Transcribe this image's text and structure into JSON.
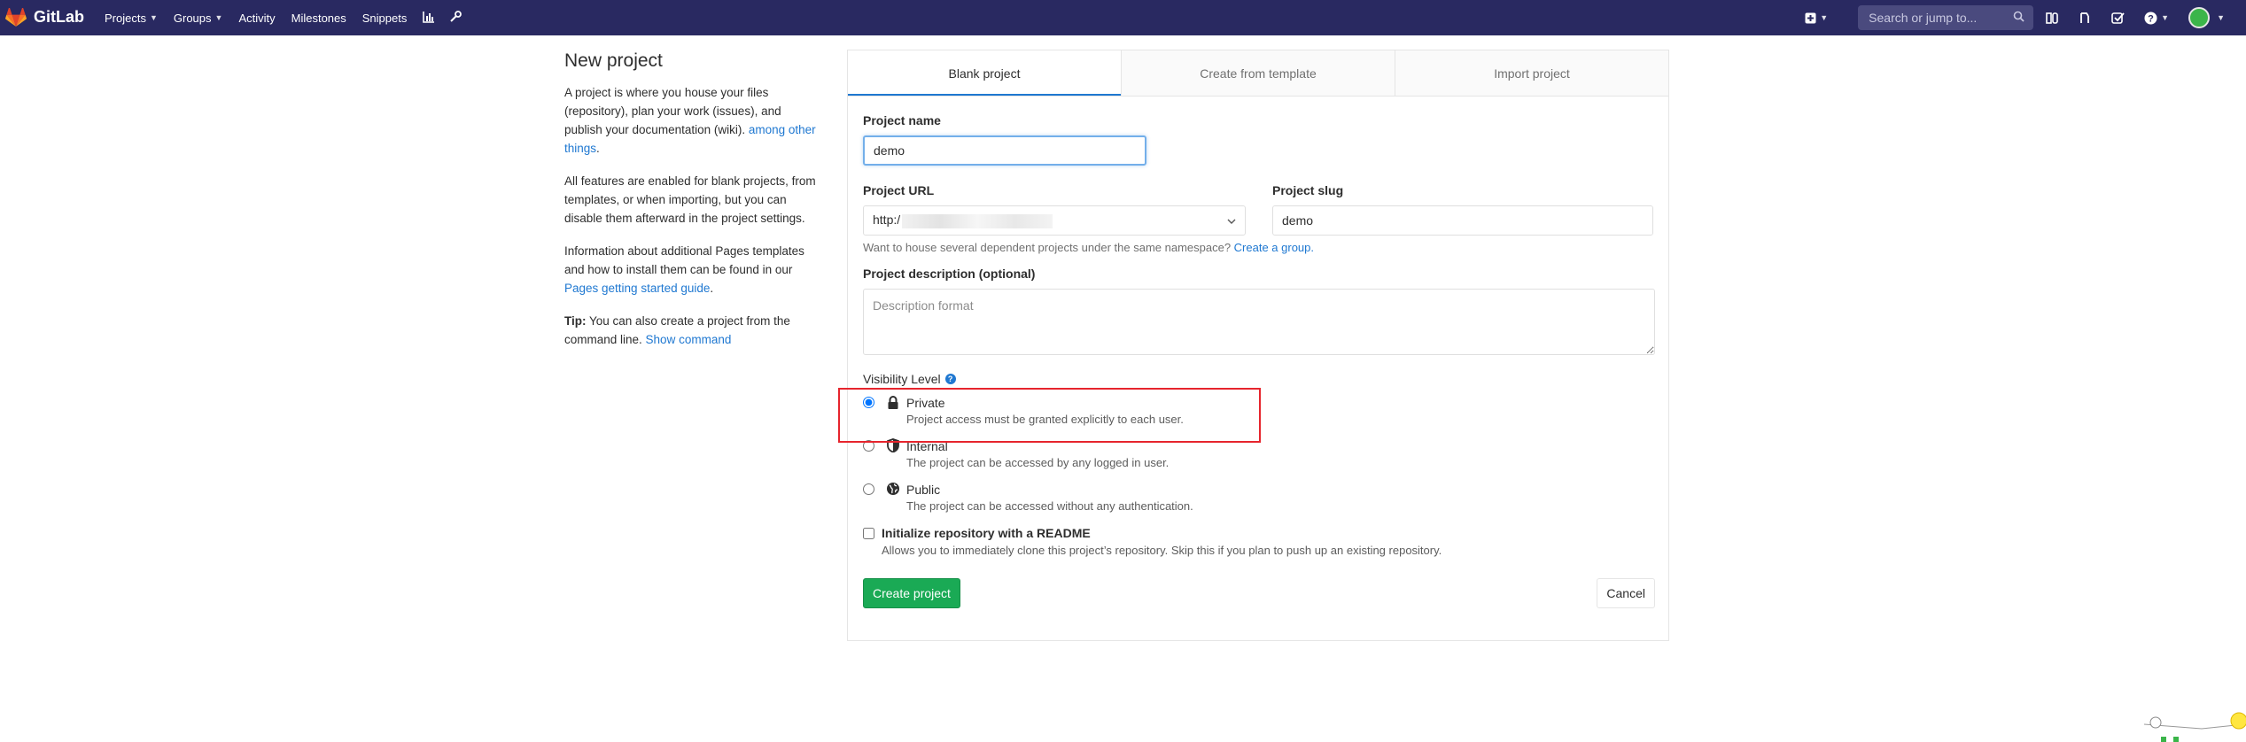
{
  "navbar": {
    "brand": "GitLab",
    "links": [
      {
        "label": "Projects",
        "caret": true
      },
      {
        "label": "Groups",
        "caret": true
      },
      {
        "label": "Activity",
        "caret": false
      },
      {
        "label": "Milestones",
        "caret": false
      },
      {
        "label": "Snippets",
        "caret": false
      }
    ],
    "search_placeholder": "Search or jump to...",
    "colors": {
      "background": "#292961",
      "search_bg": "#4a4a7e"
    }
  },
  "info": {
    "title": "New project",
    "p1_text": "A project is where you house your files (repository), plan your work (issues), and publish your documentation (wiki). ",
    "p1_link": "among other things",
    "p1_end": ".",
    "p2_text": "All features are enabled for blank projects, from templates, or when importing, but you can disable them afterward in the project settings.",
    "p3_text": "Information about additional Pages templates and how to install them can be found in our ",
    "p3_link": "Pages getting started guide",
    "p3_end": ".",
    "tip_label": "Tip:",
    "tip_text": " You can also create a project from the command line. ",
    "tip_link": "Show command"
  },
  "tabs": [
    "Blank project",
    "Create from template",
    "Import project"
  ],
  "form": {
    "project_name_label": "Project name",
    "project_name_value": "demo",
    "project_url_label": "Project URL",
    "project_url_value": "http:/",
    "project_slug_label": "Project slug",
    "project_slug_value": "demo",
    "namespace_help": "Want to house several dependent projects under the same namespace? ",
    "namespace_link": "Create a group.",
    "description_label": "Project description (optional)",
    "description_placeholder": "Description format",
    "visibility_label": "Visibility Level",
    "visibility_options": [
      {
        "title": "Private",
        "desc": "Project access must be granted explicitly to each user.",
        "icon": "lock-icon",
        "checked": true
      },
      {
        "title": "Internal",
        "desc": "The project can be accessed by any logged in user.",
        "icon": "shield-icon",
        "checked": false
      },
      {
        "title": "Public",
        "desc": "The project can be accessed without any authentication.",
        "icon": "globe-icon",
        "checked": false
      }
    ],
    "readme_title": "Initialize repository with a README",
    "readme_desc": "Allows you to immediately clone this project’s repository. Skip this if you plan to push up an existing repository.",
    "create_button": "Create project",
    "cancel_button": "Cancel"
  },
  "colors": {
    "link": "#1f78d1",
    "primary_button": "#1aaa55",
    "highlight_box": "#e6252d",
    "tab_active_underline": "#1f78d1"
  }
}
